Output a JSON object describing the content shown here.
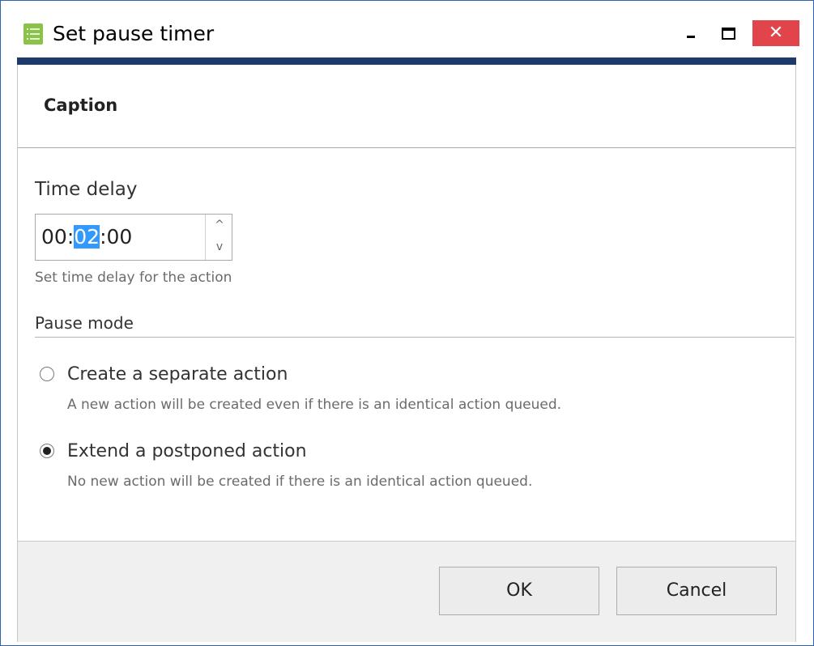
{
  "window": {
    "title": "Set pause timer",
    "icon": "list-app-icon",
    "close_glyph": "✕",
    "accent_color": "#1d3a6b",
    "close_color": "#e2444b"
  },
  "caption": {
    "text": "Caption"
  },
  "time_delay": {
    "label": "Time delay",
    "hours": "00",
    "minutes": "02",
    "seconds": "00",
    "separator": ":",
    "selected_segment": "minutes",
    "helper": "Set time delay for the action",
    "spin_up_glyph": "^",
    "spin_down_glyph": "v"
  },
  "pause_mode": {
    "label": "Pause mode",
    "options": [
      {
        "label": "Create a separate action",
        "description": "A new action will be created even if there is an identical action queued.",
        "selected": false
      },
      {
        "label": "Extend a postponed action",
        "description": "No new action will be created if there is an identical action queued.",
        "selected": true
      }
    ]
  },
  "footer": {
    "ok_label": "OK",
    "cancel_label": "Cancel"
  }
}
